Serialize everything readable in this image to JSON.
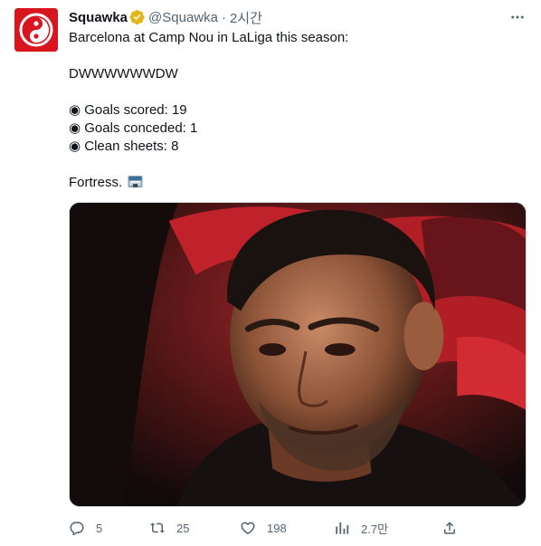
{
  "author": {
    "name": "Squawka",
    "handle": "@Squawka",
    "separator": "·",
    "time": "2시간",
    "verified": true
  },
  "tweet": {
    "lines": [
      "Barcelona at Camp Nou in LaLiga this season:",
      "DWWWWWWDW",
      "◉ Goals scored: 19",
      "◉ Goals conceded: 1",
      "◉ Clean sheets: 8",
      "Fortress."
    ],
    "emoji": "stadium-icon"
  },
  "media": {
    "kind": "photo"
  },
  "actions": {
    "replies": "5",
    "retweets": "25",
    "likes": "198",
    "views": "2.7만"
  },
  "colors": {
    "brand": "#d8141e",
    "verified": "#e2b719",
    "muted": "#536471",
    "text": "#0f1419"
  }
}
